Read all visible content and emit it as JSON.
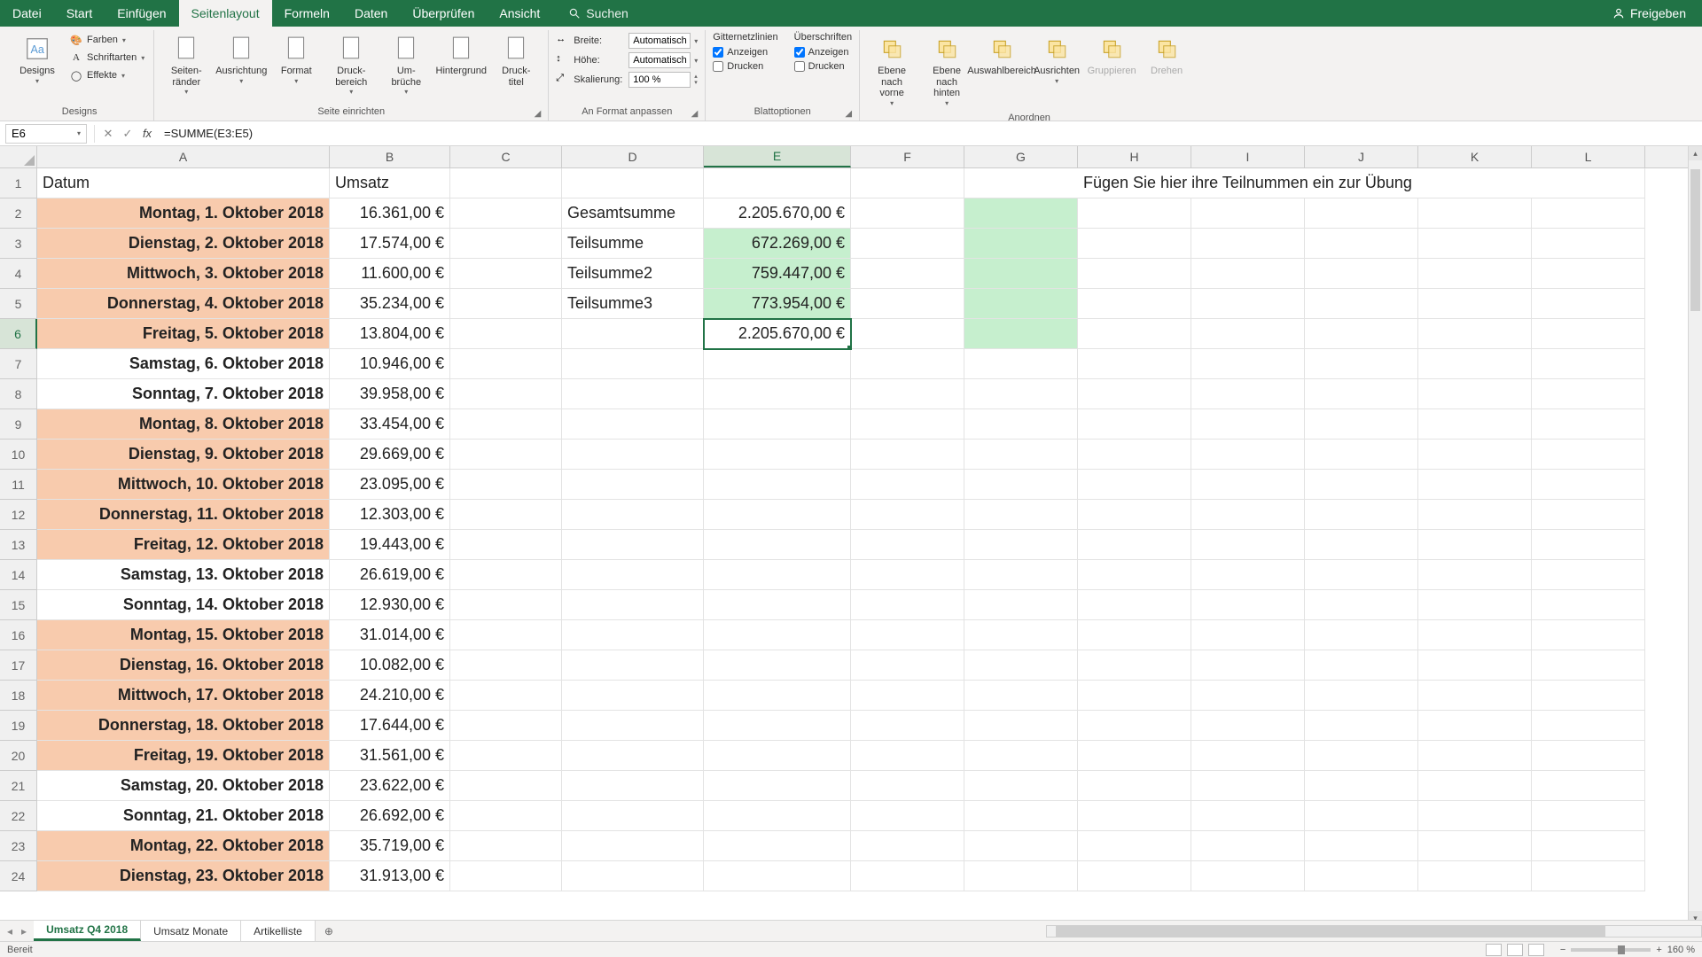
{
  "menubar": {
    "tabs": [
      "Datei",
      "Start",
      "Einfügen",
      "Seitenlayout",
      "Formeln",
      "Daten",
      "Überprüfen",
      "Ansicht"
    ],
    "active": 3,
    "search": "Suchen",
    "share": "Freigeben"
  },
  "ribbon": {
    "designs": {
      "btn": "Designs",
      "colors": "Farben",
      "fonts": "Schriftarten",
      "effects": "Effekte",
      "group": "Designs"
    },
    "page_setup": {
      "margins": "Seiten-\nränder",
      "orientation": "Ausrichtung",
      "size": "Format",
      "print_area": "Druck-\nbereich",
      "breaks": "Um-\nbrüche",
      "background": "Hintergrund",
      "print_titles": "Druck-\ntitel",
      "group": "Seite einrichten"
    },
    "scale": {
      "width_l": "Breite:",
      "width_v": "Automatisch",
      "height_l": "Höhe:",
      "height_v": "Automatisch",
      "scale_l": "Skalierung:",
      "scale_v": "100 %",
      "group": "An Format anpassen"
    },
    "sheet_opts": {
      "grid_h": "Gitternetzlinien",
      "head_h": "Überschriften",
      "view": "Anzeigen",
      "print": "Drucken",
      "group": "Blattoptionen"
    },
    "arrange": {
      "forward": "Ebene nach\nvorne",
      "backward": "Ebene nach\nhinten",
      "selpane": "Auswahlbereich",
      "align": "Ausrichten",
      "group_btn": "Gruppieren",
      "rotate": "Drehen",
      "group": "Anordnen"
    }
  },
  "formula_bar": {
    "name": "E6",
    "formula": "=SUMME(E3:E5)"
  },
  "columns": [
    "A",
    "B",
    "C",
    "D",
    "E",
    "F",
    "G",
    "H",
    "I",
    "J",
    "K",
    "L"
  ],
  "selected_col": "E",
  "selected_row": 6,
  "header": {
    "A1": "Datum",
    "B1": "Umsatz",
    "G1": "Fügen Sie hier ihre Teilnummen ein zur Übung"
  },
  "summary": {
    "D2": "Gesamtsumme",
    "E2": "2.205.670,00 €",
    "D3": "Teilsumme",
    "E3": "672.269,00 €",
    "D4": "Teilsumme2",
    "E4": "759.447,00 €",
    "D5": "Teilsumme3",
    "E5": "773.954,00 €",
    "E6": "2.205.670,00 €"
  },
  "data_rows": [
    {
      "r": 2,
      "a": "Montag, 1. Oktober 2018",
      "b": "16.361,00 €",
      "p": true
    },
    {
      "r": 3,
      "a": "Dienstag, 2. Oktober 2018",
      "b": "17.574,00 €",
      "p": true
    },
    {
      "r": 4,
      "a": "Mittwoch, 3. Oktober 2018",
      "b": "11.600,00 €",
      "p": true
    },
    {
      "r": 5,
      "a": "Donnerstag, 4. Oktober 2018",
      "b": "35.234,00 €",
      "p": true
    },
    {
      "r": 6,
      "a": "Freitag, 5. Oktober 2018",
      "b": "13.804,00 €",
      "p": true
    },
    {
      "r": 7,
      "a": "Samstag, 6. Oktober 2018",
      "b": "10.946,00 €",
      "p": false
    },
    {
      "r": 8,
      "a": "Sonntag, 7. Oktober 2018",
      "b": "39.958,00 €",
      "p": false
    },
    {
      "r": 9,
      "a": "Montag, 8. Oktober 2018",
      "b": "33.454,00 €",
      "p": true
    },
    {
      "r": 10,
      "a": "Dienstag, 9. Oktober 2018",
      "b": "29.669,00 €",
      "p": true
    },
    {
      "r": 11,
      "a": "Mittwoch, 10. Oktober 2018",
      "b": "23.095,00 €",
      "p": true
    },
    {
      "r": 12,
      "a": "Donnerstag, 11. Oktober 2018",
      "b": "12.303,00 €",
      "p": true
    },
    {
      "r": 13,
      "a": "Freitag, 12. Oktober 2018",
      "b": "19.443,00 €",
      "p": true
    },
    {
      "r": 14,
      "a": "Samstag, 13. Oktober 2018",
      "b": "26.619,00 €",
      "p": false
    },
    {
      "r": 15,
      "a": "Sonntag, 14. Oktober 2018",
      "b": "12.930,00 €",
      "p": false
    },
    {
      "r": 16,
      "a": "Montag, 15. Oktober 2018",
      "b": "31.014,00 €",
      "p": true
    },
    {
      "r": 17,
      "a": "Dienstag, 16. Oktober 2018",
      "b": "10.082,00 €",
      "p": true
    },
    {
      "r": 18,
      "a": "Mittwoch, 17. Oktober 2018",
      "b": "24.210,00 €",
      "p": true
    },
    {
      "r": 19,
      "a": "Donnerstag, 18. Oktober 2018",
      "b": "17.644,00 €",
      "p": true
    },
    {
      "r": 20,
      "a": "Freitag, 19. Oktober 2018",
      "b": "31.561,00 €",
      "p": true
    },
    {
      "r": 21,
      "a": "Samstag, 20. Oktober 2018",
      "b": "23.622,00 €",
      "p": false
    },
    {
      "r": 22,
      "a": "Sonntag, 21. Oktober 2018",
      "b": "26.692,00 €",
      "p": false
    },
    {
      "r": 23,
      "a": "Montag, 22. Oktober 2018",
      "b": "35.719,00 €",
      "p": true
    },
    {
      "r": 24,
      "a": "Dienstag, 23. Oktober 2018",
      "b": "31.913,00 €",
      "p": true
    }
  ],
  "sheets": {
    "tabs": [
      "Umsatz Q4 2018",
      "Umsatz Monate",
      "Artikelliste"
    ],
    "active": 0
  },
  "status": {
    "ready": "Bereit",
    "zoom": "160 %"
  }
}
